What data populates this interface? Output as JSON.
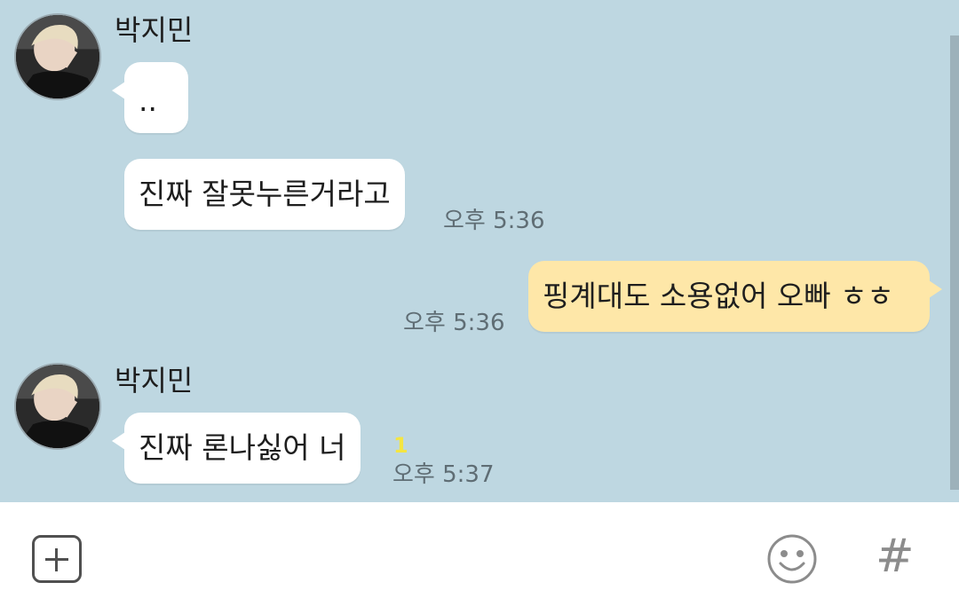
{
  "messages": [
    {
      "sender": "박지민",
      "texts": [
        ".."
      ]
    },
    {
      "text": "진짜 잘못누른거라고",
      "time": "오후 5:36"
    },
    {
      "mine": true,
      "text": "핑계대도 소용없어 오빠 ㅎㅎ",
      "time": "오후 5:36"
    },
    {
      "sender": "박지민",
      "text": "진짜 론나싫어 너",
      "unread": "1",
      "time": "오후 5:37"
    }
  ],
  "input_bar": {
    "add_icon": "plus-square-icon",
    "emoji_icon": "smiley-icon",
    "hash_icon": "#"
  },
  "colors": {
    "chat_background": "#bed7e1",
    "my_bubble": "#fee7a8",
    "their_bubble": "#ffffff",
    "unread_count": "#f4e542"
  }
}
